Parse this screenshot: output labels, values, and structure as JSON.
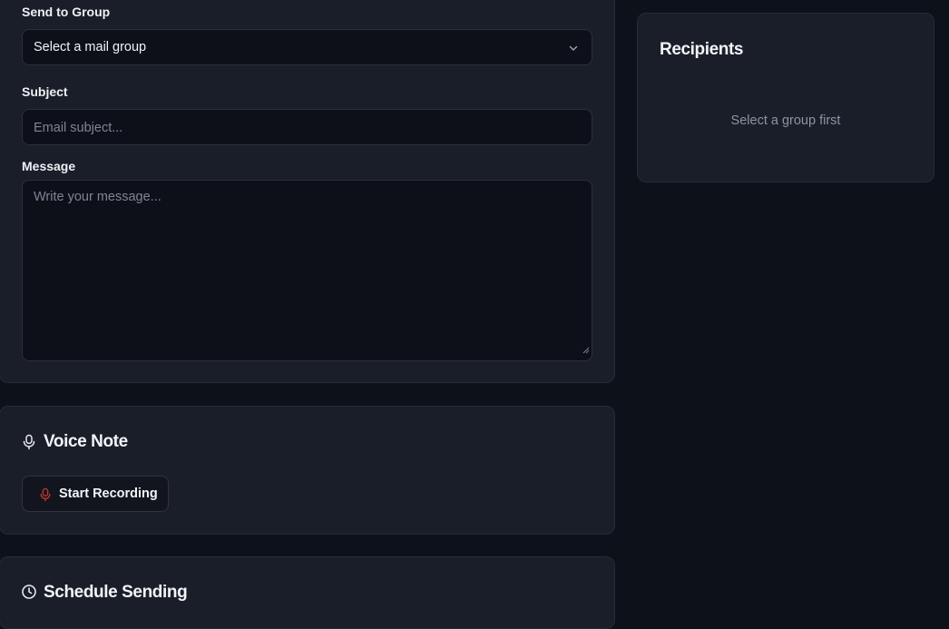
{
  "compose": {
    "group_label": "Send to Group",
    "group_select": {
      "value": "Select a mail group"
    },
    "subject_label": "Subject",
    "subject_placeholder": "Email subject...",
    "message_label": "Message",
    "message_placeholder": "Write your message..."
  },
  "voice": {
    "title": "Voice Note",
    "record_label": "Start Recording",
    "record_icon_color": "#c0352c"
  },
  "schedule": {
    "title": "Schedule Sending"
  },
  "recipients": {
    "title": "Recipients",
    "empty_message": "Select a group first"
  },
  "icons": [
    "chevron-down-icon",
    "microphone-icon",
    "clock-icon",
    "resize-handle-icon"
  ]
}
